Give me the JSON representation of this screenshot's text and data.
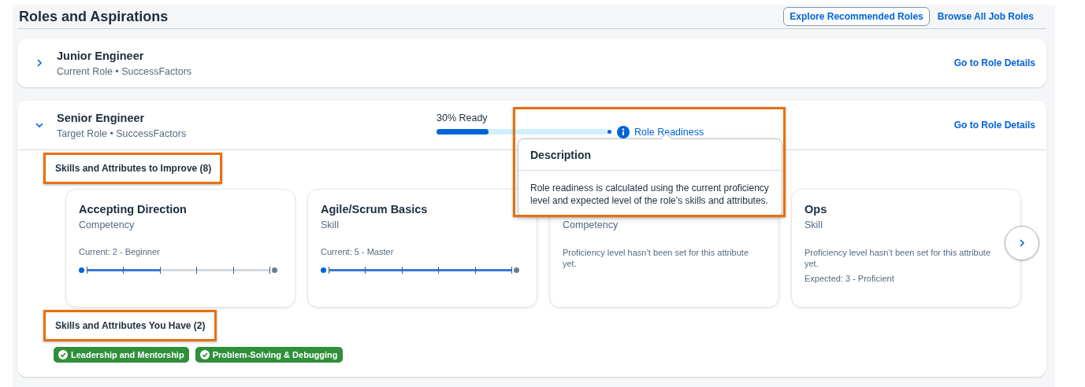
{
  "page": {
    "title": "Roles and Aspirations",
    "actions": [
      {
        "kind": "button",
        "label": "Explore Recommended Roles"
      },
      {
        "kind": "link",
        "label": "Browse All Job Roles"
      }
    ]
  },
  "roles": [
    {
      "title": "Junior Engineer",
      "subtitle": "Current Role • SuccessFactors",
      "expanded": false,
      "link": "Go to Role Details"
    },
    {
      "title": "Senior Engineer",
      "subtitle": "Target Role • SuccessFactors",
      "expanded": true,
      "link": "Go to Role Details",
      "readiness": {
        "label": "30% Ready",
        "level": 0.3,
        "link": "Role Readiness",
        "highlighted": true,
        "popover": {
          "title": "Description",
          "text": "Role readiness is calculated using the current proficiency level and expected level of the role’s skills and attributes."
        }
      },
      "improve": {
        "heading": "Skills and Attributes to Improve (8)",
        "highlighted": true,
        "cards": [
          {
            "title": "Accepting Direction",
            "type": "Competency",
            "current": "Current: 2 - Beginner",
            "level": 0.4
          },
          {
            "title": "Agile/Scrum Basics",
            "type": "Skill",
            "current": "Current: 5 - Master",
            "level": 1
          },
          {
            "type": "Competency",
            "note": "Proficiency level hasn’t been set for this attribute yet."
          },
          {
            "title": "Ops",
            "type": "Skill",
            "note": "Proficiency level hasn’t been set for this attribute yet.",
            "expected": "Expected: 3 - Proficient"
          }
        ]
      },
      "have": {
        "heading": "Skills and Attributes You Have (2)",
        "highlighted": true,
        "tags": [
          "Leadership and Mentorship",
          "Problem-Solving & Debugging"
        ]
      }
    }
  ]
}
